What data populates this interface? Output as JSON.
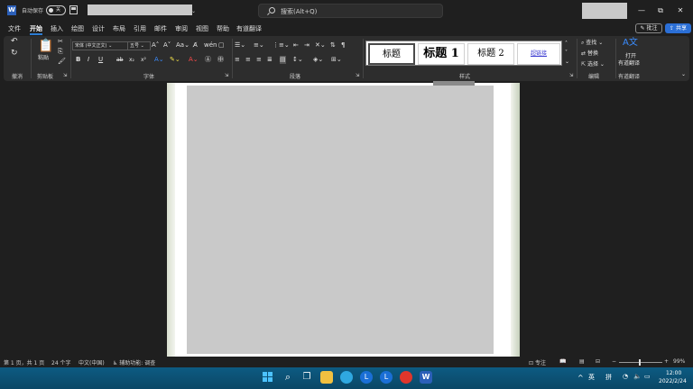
{
  "titlebar": {
    "app_logo": "W",
    "autosave_label": "自动保存",
    "autosave_state": "关",
    "search_placeholder": "搜索(Alt+Q)",
    "minimize": "—",
    "restore": "⧉",
    "close": "✕"
  },
  "tabs": [
    "文件",
    "开始",
    "插入",
    "绘图",
    "设计",
    "布局",
    "引用",
    "邮件",
    "审阅",
    "视图",
    "帮助",
    "有道翻译"
  ],
  "active_tab": "开始",
  "comment_label": "批注",
  "share_label": "共享",
  "ribbon": {
    "groups": {
      "undo": "撤消",
      "clipboard": "剪贴板",
      "font": "字体",
      "paragraph": "段落",
      "styles": "样式",
      "editing": "编辑",
      "translate": "有道翻译"
    },
    "paste_label": "粘贴",
    "font_name": "宋体 (中文正文)",
    "font_size": "五号",
    "font_buttons": [
      "B",
      "I",
      "U",
      "ab",
      "x₂",
      "x²"
    ],
    "styles": [
      "标题",
      "标题 1",
      "标题 2",
      "超链接"
    ],
    "editing": [
      "查找",
      "替换",
      "选择"
    ],
    "translate_label_1": "打开",
    "translate_label_2": "有道翻译"
  },
  "statusbar": {
    "page_info": "第 1 页，共 1 页",
    "word_count": "24 个字",
    "language": "中文(中国)",
    "accessibility": "辅助功能: 调查",
    "focus": "专注",
    "zoom": "99%"
  },
  "taskbar": {
    "ime_lang": "英",
    "ime_mode": "拼",
    "time": "12:00",
    "date": "2022/2/24"
  },
  "colors": {
    "accent": "#2b7cd3",
    "share": "#2b6fd6",
    "taskbar": "#0d5b82"
  }
}
